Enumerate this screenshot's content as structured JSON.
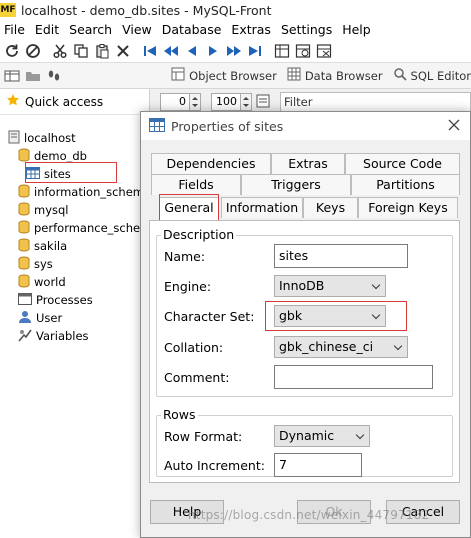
{
  "window": {
    "logo": "MF",
    "title": "localhost - demo_db.sites - MySQL-Front"
  },
  "menu": [
    "File",
    "Edit",
    "Search",
    "View",
    "Database",
    "Extras",
    "Settings",
    "Help"
  ],
  "toolbar2": {
    "object_browser": "Object Browser",
    "data_browser": "Data Browser",
    "sql_editor": "SQL Editor"
  },
  "tree": {
    "quick_access": "Quick access",
    "server": "localhost",
    "databases": [
      "demo_db",
      "information_schema",
      "mysql",
      "performance_schema",
      "sakila",
      "sys",
      "world"
    ],
    "selected_table": "sites",
    "processes": "Processes",
    "users": "User",
    "variables": "Variables"
  },
  "content": {
    "offset": "0",
    "limit": "100",
    "filter": "Filter"
  },
  "dialog": {
    "title": "Properties of sites",
    "tabs_row1": [
      "Dependencies",
      "Extras",
      "Source Code"
    ],
    "tabs_row2": [
      "Fields",
      "Triggers",
      "Partitions"
    ],
    "tabs_row3": [
      "General",
      "Information",
      "Keys",
      "Foreign Keys"
    ],
    "description_title": "Description",
    "name_label": "Name:",
    "name_value": "sites",
    "engine_label": "Engine:",
    "engine_value": "InnoDB",
    "charset_label": "Character Set:",
    "charset_value": "gbk",
    "collation_label": "Collation:",
    "collation_value": "gbk_chinese_ci",
    "comment_label": "Comment:",
    "comment_value": "",
    "rows_title": "Rows",
    "row_format_label": "Row Format:",
    "row_format_value": "Dynamic",
    "auto_inc_label": "Auto Increment:",
    "auto_inc_value": "7",
    "help_button": "Help",
    "ok_button": "Ok",
    "cancel_button": "Cancel"
  },
  "watermark": "https://blog.csdn.net/weixin_44797182",
  "colors": {
    "highlight_red": "#d93a3a",
    "folder_yellow": "#f3c24b",
    "db_yellow": "#e8b84a",
    "star": "#f5b400"
  }
}
